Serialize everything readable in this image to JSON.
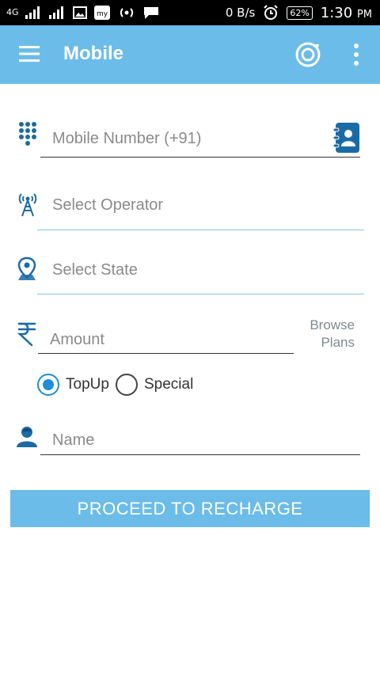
{
  "status_bar": {
    "network_type": "4G",
    "data_rate": "0 B/s",
    "battery": "62%",
    "time": "1:30",
    "ampm": "PM"
  },
  "appbar": {
    "title": "Mobile",
    "menu_icon": "menu-icon",
    "refresh_icon": "refresh-icon",
    "more_icon": "more-vert-icon"
  },
  "form": {
    "mobile": {
      "placeholder": "Mobile Number (+91)",
      "value": ""
    },
    "operator": {
      "placeholder": "Select Operator",
      "value": ""
    },
    "state": {
      "placeholder": "Select State",
      "value": ""
    },
    "amount": {
      "placeholder": "Amount",
      "value": ""
    },
    "browse_line1": "Browse",
    "browse_line2": "Plans",
    "recharge_types": [
      {
        "label": "TopUp",
        "checked": true
      },
      {
        "label": "Special",
        "checked": false
      }
    ],
    "name": {
      "placeholder": "Name",
      "value": ""
    }
  },
  "proceed_label": "PROCEED TO RECHARGE",
  "colors": {
    "primary": "#6bbce8",
    "accent": "#1e8fd6",
    "icon": "#1b6aa5"
  }
}
